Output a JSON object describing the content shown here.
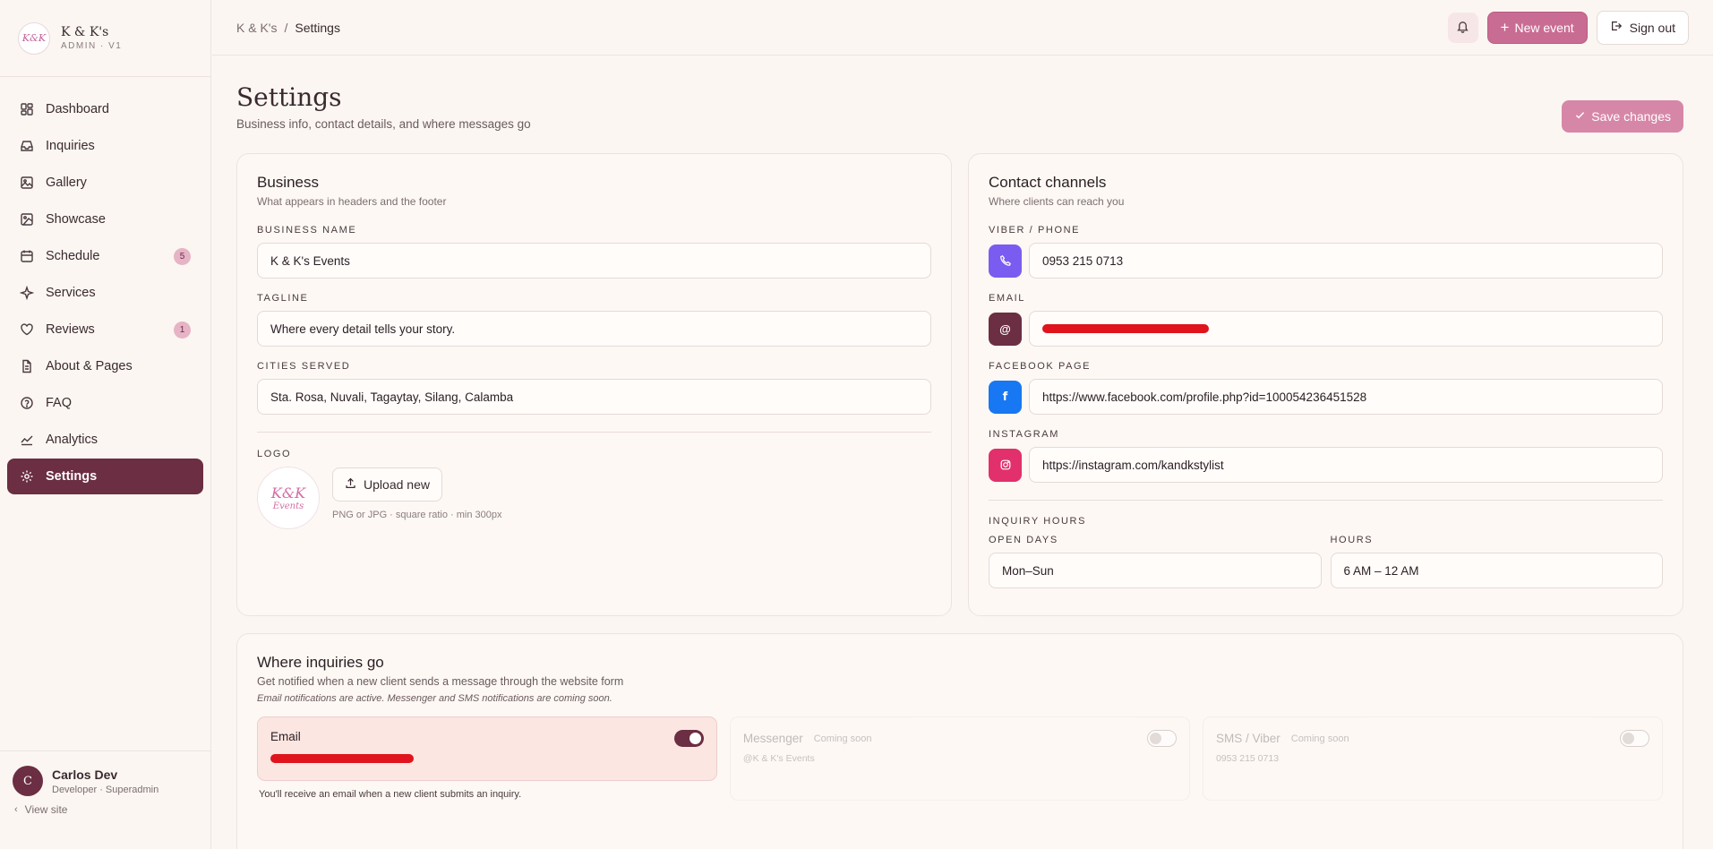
{
  "brand": {
    "name": "K & K's",
    "sub": "ADMIN · V1",
    "logo_text": "K&K"
  },
  "nav": [
    {
      "label": "Dashboard",
      "icon": "dashboard-icon"
    },
    {
      "label": "Inquiries",
      "icon": "inbox-icon"
    },
    {
      "label": "Gallery",
      "icon": "image-icon"
    },
    {
      "label": "Showcase",
      "icon": "showcase-icon"
    },
    {
      "label": "Schedule",
      "icon": "calendar-icon",
      "badge": "5"
    },
    {
      "label": "Services",
      "icon": "sparkle-icon"
    },
    {
      "label": "Reviews",
      "icon": "heart-icon",
      "badge": "1"
    },
    {
      "label": "About & Pages",
      "icon": "document-icon"
    },
    {
      "label": "FAQ",
      "icon": "help-icon"
    },
    {
      "label": "Analytics",
      "icon": "chart-icon"
    },
    {
      "label": "Settings",
      "icon": "gear-icon",
      "active": true
    }
  ],
  "user": {
    "initial": "C",
    "name": "Carlos Dev",
    "role": "Developer · Superadmin",
    "view_site": "View site"
  },
  "topbar": {
    "crumb_root": "K & K's",
    "crumb_sep": "/",
    "crumb_current": "Settings",
    "new_event": "New event",
    "sign_out": "Sign out"
  },
  "page": {
    "title": "Settings",
    "subtitle": "Business info, contact details, and where messages go",
    "save": "Save changes"
  },
  "business": {
    "title": "Business",
    "subtitle": "What appears in headers and the footer",
    "name_label": "BUSINESS NAME",
    "name_value": "K & K's Events",
    "tagline_label": "TAGLINE",
    "tagline_value": "Where every detail tells your story.",
    "cities_label": "CITIES SERVED",
    "cities_value": "Sta. Rosa, Nuvali, Tagaytay, Silang, Calamba",
    "logo_label": "LOGO",
    "upload": "Upload new",
    "logo_hint": "PNG or JPG · square ratio · min 300px",
    "logo_text": "K&K",
    "logo_subtext": "Events"
  },
  "contact": {
    "title": "Contact channels",
    "subtitle": "Where clients can reach you",
    "phone_label": "VIBER / PHONE",
    "phone_value": "0953 215 0713",
    "email_label": "EMAIL",
    "email_value": "",
    "facebook_label": "FACEBOOK PAGE",
    "facebook_value": "https://www.facebook.com/profile.php?id=100054236451528",
    "facebook_glyph": "f",
    "instagram_label": "INSTAGRAM",
    "instagram_value": "https://instagram.com/kandkstylist",
    "email_glyph": "@",
    "hours_label": "INQUIRY HOURS",
    "days_label": "OPEN DAYS",
    "days_value": "Mon–Sun",
    "hours_sub_label": "HOURS",
    "hours_value": "6 AM – 12 AM",
    "colors": {
      "phone": "#7b5cf0",
      "email": "#6b2e42",
      "facebook": "#1877f2",
      "instagram": "#e1306c"
    }
  },
  "inquiries": {
    "title": "Where inquiries go",
    "subtitle": "Get notified when a new client sends a message through the website form",
    "note": "Email notifications are active. Messenger and SMS notifications are coming soon.",
    "email": {
      "label": "Email",
      "help": "You'll receive an email when a new client submits an inquiry.",
      "enabled": true
    },
    "messenger": {
      "label": "Messenger",
      "tag": "Coming soon",
      "detail": "@K & K's Events",
      "enabled": false
    },
    "sms": {
      "label": "SMS / Viber",
      "tag": "Coming soon",
      "detail": "0953 215 0713",
      "enabled": false
    }
  }
}
